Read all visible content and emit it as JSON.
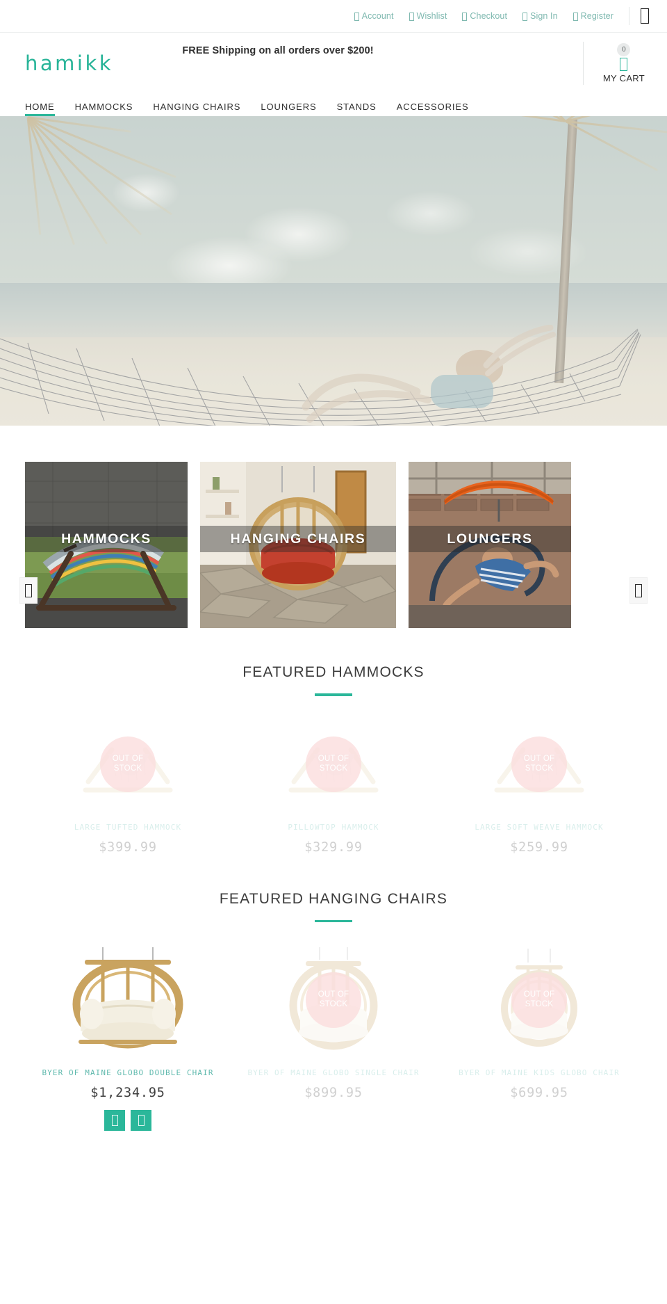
{
  "brand": {
    "logo_text": "hamikk",
    "accent_color": "#2bb79a"
  },
  "utility_bar": {
    "links": [
      {
        "label": "Account",
        "icon": "user-icon"
      },
      {
        "label": "Wishlist",
        "icon": "heart-icon"
      },
      {
        "label": "Checkout",
        "icon": "cart-icon"
      },
      {
        "label": "Sign In",
        "icon": "lock-icon"
      },
      {
        "label": "Register",
        "icon": "pencil-icon"
      }
    ],
    "search_icon": "search-icon"
  },
  "header": {
    "shipping_message": "FREE Shipping on all orders over $200!",
    "cart": {
      "count": "0",
      "label": "MY CART",
      "icon": "cart-icon"
    }
  },
  "nav": {
    "items": [
      {
        "label": "HOME",
        "active": true
      },
      {
        "label": "HAMMOCKS",
        "active": false
      },
      {
        "label": "HANGING CHAIRS",
        "active": false
      },
      {
        "label": "LOUNGERS",
        "active": false
      },
      {
        "label": "STANDS",
        "active": false
      },
      {
        "label": "ACCESSORIES",
        "active": false
      }
    ]
  },
  "hero": {
    "alt": "Woman relaxing in a rope hammock on a tropical beach with palm trees"
  },
  "categories": {
    "prev_icon": "chevron-left-icon",
    "next_icon": "chevron-right-icon",
    "tiles": [
      {
        "label": "HAMMOCKS"
      },
      {
        "label": "HANGING CHAIRS"
      },
      {
        "label": "LOUNGERS"
      }
    ]
  },
  "sections": [
    {
      "title": "FEATURED HAMMOCKS",
      "products": [
        {
          "name": "LARGE TUFTED HAMMOCK",
          "price": "$399.99",
          "out_of_stock": true,
          "badge": "OUT OF\nSTOCK"
        },
        {
          "name": "PILLOWTOP HAMMOCK",
          "price": "$329.99",
          "out_of_stock": true,
          "badge": "OUT OF\nSTOCK"
        },
        {
          "name": "LARGE SOFT WEAVE HAMMOCK",
          "price": "$259.99",
          "out_of_stock": true,
          "badge": "OUT OF\nSTOCK"
        }
      ]
    },
    {
      "title": "FEATURED HANGING CHAIRS",
      "products": [
        {
          "name": "BYER OF MAINE GLOBO DOUBLE CHAIR",
          "price": "$1,234.95",
          "out_of_stock": false,
          "actions": [
            {
              "icon": "cart-icon"
            },
            {
              "icon": "heart-icon"
            }
          ]
        },
        {
          "name": "BYER OF MAINE GLOBO SINGLE CHAIR",
          "price": "$899.95",
          "out_of_stock": true,
          "badge": "OUT OF\nSTOCK"
        },
        {
          "name": "BYER OF MAINE KIDS GLOBO CHAIR",
          "price": "$699.95",
          "out_of_stock": true,
          "badge": "OUT OF\nSTOCK"
        }
      ]
    }
  ],
  "out_of_stock_text": {
    "line1": "OUT OF",
    "line2": "STOCK"
  }
}
